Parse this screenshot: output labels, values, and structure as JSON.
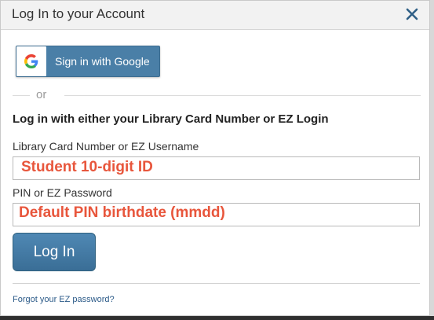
{
  "header": {
    "title": "Log In to your Account",
    "close_icon": "close-icon"
  },
  "google": {
    "label": "Sign in with Google",
    "icon": "google-g-icon"
  },
  "separator": {
    "or_text": "or"
  },
  "form": {
    "heading": "Log in with either your Library Card Number or EZ Login",
    "username_label": "Library Card Number or EZ Username",
    "username_annotation": "Student 10-digit ID",
    "password_label": "PIN or EZ Password",
    "password_annotation": "Default PIN birthdate (mmdd)",
    "login_label": "Log In",
    "forgot_link": "Forgot your EZ password?"
  },
  "colors": {
    "accent_button": "#4a7fa7",
    "annotation_text": "#e8563c",
    "link": "#2b5a88"
  }
}
